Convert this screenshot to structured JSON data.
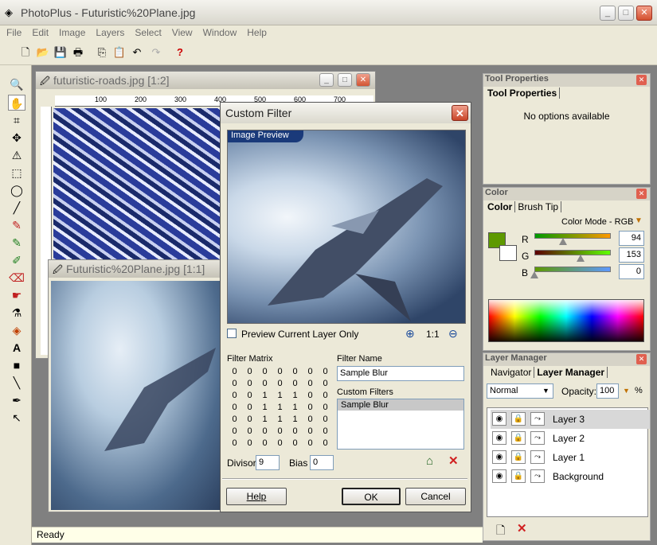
{
  "app": {
    "title": "PhotoPlus - Futuristic%20Plane.jpg",
    "menu": [
      "File",
      "Edit",
      "Image",
      "Layers",
      "Select",
      "View",
      "Window",
      "Help"
    ]
  },
  "windows": {
    "roads": {
      "title": "futuristic-roads.jpg [1:2]",
      "ruler": [
        "100",
        "200",
        "300",
        "400",
        "500",
        "600",
        "700"
      ]
    },
    "plane": {
      "title": "Futuristic%20Plane.jpg [1:1]"
    }
  },
  "dialog": {
    "title": "Custom Filter",
    "preview_label": "Image Preview",
    "preview_checkbox": "Preview Current Layer Only",
    "zoom_label": "1:1",
    "matrix_label": "Filter Matrix",
    "matrix": [
      [
        0,
        0,
        0,
        0,
        0,
        0,
        0
      ],
      [
        0,
        0,
        0,
        0,
        0,
        0,
        0
      ],
      [
        0,
        0,
        1,
        1,
        1,
        0,
        0
      ],
      [
        0,
        0,
        1,
        1,
        1,
        0,
        0
      ],
      [
        0,
        0,
        1,
        1,
        1,
        0,
        0
      ],
      [
        0,
        0,
        0,
        0,
        0,
        0,
        0
      ],
      [
        0,
        0,
        0,
        0,
        0,
        0,
        0
      ]
    ],
    "filter_name_label": "Filter Name",
    "filter_name_value": "Sample Blur",
    "custom_filters_label": "Custom Filters",
    "custom_filters": [
      "Sample Blur"
    ],
    "divisor_label": "Divisor",
    "divisor_value": "9",
    "bias_label": "Bias",
    "bias_value": "0",
    "help_button": "Help",
    "ok_button": "OK",
    "cancel_button": "Cancel"
  },
  "panels": {
    "tool_properties": {
      "title": "Tool Properties",
      "tab": "Tool Properties",
      "message": "No options available"
    },
    "color": {
      "title": "Color",
      "tabs": [
        "Color",
        "Brush Tip"
      ],
      "mode": "Color Mode - RGB",
      "r_label": "R",
      "r_value": "94",
      "r_level": 0.37,
      "g_label": "G",
      "g_value": "153",
      "g_level": 0.6,
      "b_label": "B",
      "b_value": "0",
      "b_level": 0.0,
      "swatch": "#5e9900"
    },
    "layers": {
      "title": "Layer Manager",
      "tabs": [
        "Navigator",
        "Layer Manager"
      ],
      "blend_mode": "Normal",
      "opacity_label": "Opacity:",
      "opacity_value": "100",
      "opacity_unit": "%",
      "items": [
        "Layer 3",
        "Layer 2",
        "Layer 1",
        "Background"
      ]
    }
  },
  "status": {
    "text": "Ready"
  }
}
